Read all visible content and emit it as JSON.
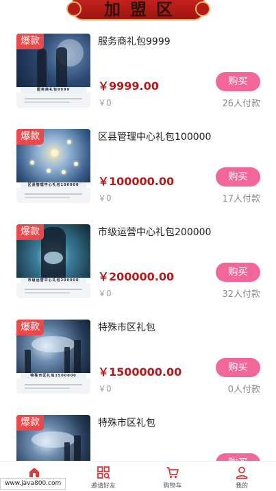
{
  "banner": {
    "title": "加盟区"
  },
  "items": [
    {
      "tag": "爆款",
      "name": "服务商礼包9999",
      "price": "￥9999.00",
      "original_price": "￥0",
      "paid": "26人付款",
      "buy_label": "购买",
      "plaque": "服务商礼包9999",
      "art": "handshake-network"
    },
    {
      "tag": "爆款",
      "name": "区县管理中心礼包100000",
      "price": "￥100000.00",
      "original_price": "￥0",
      "paid": "17人付款",
      "buy_label": "购买",
      "plaque": "区县管理中心礼包100000",
      "art": "lightbulb-network"
    },
    {
      "tag": "爆款",
      "name": "市级运营中心礼包200000",
      "price": "￥200000.00",
      "original_price": "￥0",
      "paid": "32人付款",
      "buy_label": "购买",
      "plaque": "市级运营中心礼包200000",
      "art": "businessman-globe"
    },
    {
      "tag": "爆款",
      "name": "特殊市区礼包",
      "price": "￥1500000.00",
      "original_price": "￥0",
      "paid": "0人付款",
      "buy_label": "购买",
      "plaque": "特殊市区礼包1500000",
      "art": "city-handshake"
    },
    {
      "tag": "爆款",
      "name": "特殊市区礼包",
      "price": "",
      "original_price": "",
      "paid": "",
      "buy_label": "购买",
      "plaque": "",
      "art": "city-handshake"
    }
  ],
  "tabbar": {
    "tabs": [
      {
        "label": "",
        "icon": "home-icon",
        "active": true
      },
      {
        "label": "邀请好友",
        "icon": "grid-icon",
        "active": false
      },
      {
        "label": "购物车",
        "icon": "cart-icon",
        "active": false
      },
      {
        "label": "我的",
        "icon": "user-icon",
        "active": false
      }
    ]
  },
  "watermark": {
    "text": "www.java800.com"
  },
  "colors": {
    "accent": "#f2679a",
    "price": "#b5191b",
    "tag": "#e9494a",
    "banner": "#b51b16"
  }
}
